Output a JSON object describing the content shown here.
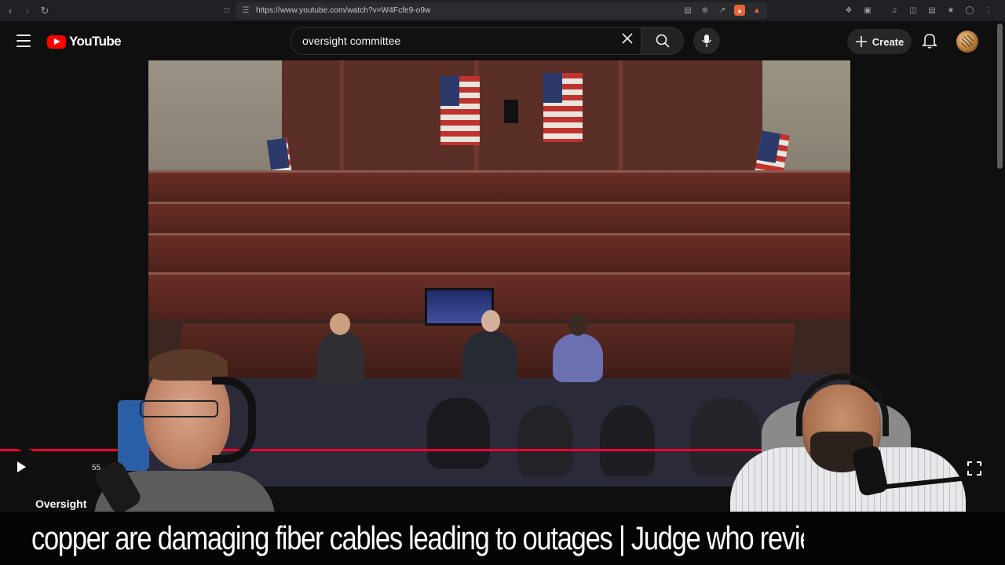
{
  "browser": {
    "url": "https://www.youtube.com/watch?v=W4Fcfe9-o9w"
  },
  "header": {
    "logo_text": "YouTube",
    "search": {
      "value": "oversight committee"
    },
    "create_label": "Create"
  },
  "player": {
    "progress_fraction": 0.766,
    "time_fragment": "55"
  },
  "overlay": {
    "title_fragment": "Oversight",
    "ticker_text": "copper are damaging fiber cables leading to outages  |  Judge who reviewed James Comey's indictment was conf"
  },
  "colors": {
    "accent": "#ff0000",
    "progress": "#ff0033",
    "background": "#0f0f0f"
  },
  "icons": [
    "back-icon",
    "forward-icon",
    "reload-icon",
    "bookmark-icon",
    "site-settings-icon",
    "menu-icon",
    "youtube-logo-icon",
    "close-icon",
    "search-icon",
    "mic-icon",
    "plus-icon",
    "bell-icon",
    "play-icon",
    "settings-icon",
    "theater-icon",
    "fullscreen-icon"
  ]
}
